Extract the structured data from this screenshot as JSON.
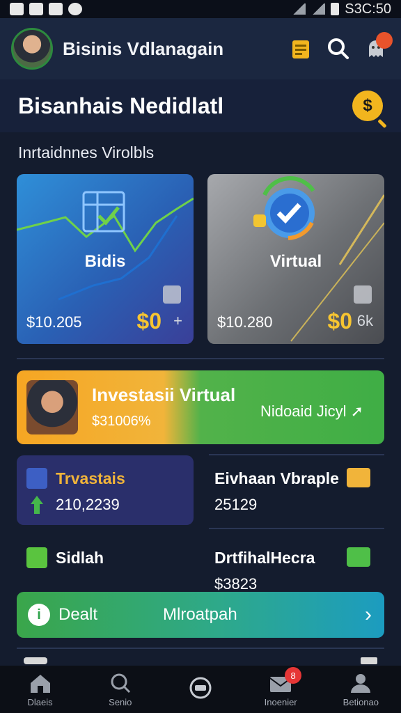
{
  "status_bar": {
    "time": "S3C:50"
  },
  "header": {
    "title": "Bisinis Vdlanagain",
    "notification_count": ""
  },
  "page": {
    "title": "Bisanhais Nedidlatl",
    "coin_symbol": "$"
  },
  "section": {
    "label": "Inrtaidnnes Virolbls"
  },
  "cards": [
    {
      "name": "Bidis",
      "amount": "$10.205 ",
      "zero": "$0",
      "extra": "+",
      "accent": "#2f8fd8"
    },
    {
      "name": "Virtual",
      "amount": "$10.280 ",
      "zero": "$0",
      "extra": "6k",
      "accent": "#9c9fa4"
    }
  ],
  "banner": {
    "title": "Investasii Virtual",
    "amount": "$31006%",
    "link": "Nidoaid Jicyl"
  },
  "tiles": [
    {
      "title": "Trvastais",
      "value": "210,2239",
      "icon_color": "#3d5fc4",
      "sub_icon_color": "#45b74b"
    },
    {
      "title": "Eivhaan Vbraple",
      "value": "25129",
      "icon_color": "#f1b43a"
    },
    {
      "title": "Sidlah",
      "value": "",
      "icon_color": "#5ac43f"
    },
    {
      "title": "DrtfihalHecra",
      "value": "$3823",
      "icon_color": "#4fbf48"
    }
  ],
  "deal": {
    "label": "Dealt",
    "center": "Mlroatpah",
    "icon": "i"
  },
  "nav": [
    {
      "label": "Dlaeis",
      "icon": "home-icon"
    },
    {
      "label": "Senio",
      "icon": "search-icon"
    },
    {
      "label": "",
      "icon": "center-action-icon"
    },
    {
      "label": "Inoenier",
      "icon": "mail-icon",
      "badge": "8"
    },
    {
      "label": "Betionao",
      "icon": "profile-icon"
    }
  ]
}
